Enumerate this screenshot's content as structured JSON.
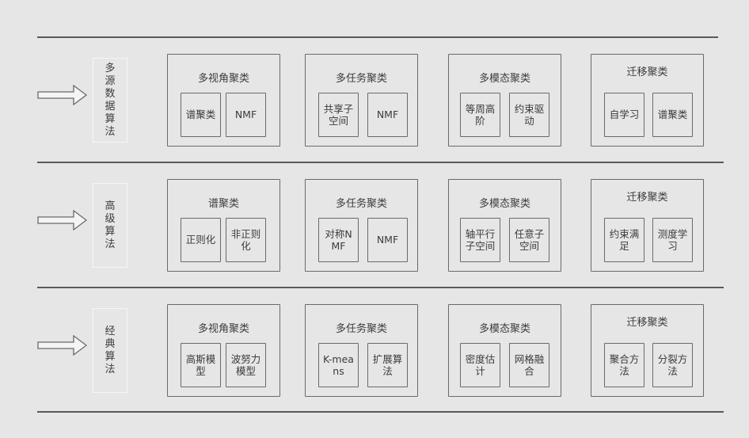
{
  "rows": [
    {
      "label": "多源数据算法",
      "groups": [
        {
          "title": "多视角聚类",
          "items": [
            "谱聚类",
            "NMF"
          ]
        },
        {
          "title": "多任务聚类",
          "items": [
            "共享子空间",
            "NMF"
          ]
        },
        {
          "title": "多模态聚类",
          "items": [
            "等周高阶",
            "约束驱动"
          ]
        },
        {
          "title": "迁移聚类",
          "items": [
            "自学习",
            "谱聚类"
          ]
        }
      ]
    },
    {
      "label": "高级算法",
      "groups": [
        {
          "title": "谱聚类",
          "items": [
            "正则化",
            "非正则化"
          ]
        },
        {
          "title": "多任务聚类",
          "items": [
            "对称NMF",
            "NMF"
          ]
        },
        {
          "title": "多模态聚类",
          "items": [
            "轴平行子空间",
            "任意子空间"
          ]
        },
        {
          "title": "迁移聚类",
          "items": [
            "约束满足",
            "测度学习"
          ]
        }
      ]
    },
    {
      "label": "经典算法",
      "groups": [
        {
          "title": "多视角聚类",
          "items": [
            "高斯模型",
            "波努力模型"
          ]
        },
        {
          "title": "多任务聚类",
          "items": [
            "K-means",
            "扩展算法"
          ]
        },
        {
          "title": "多模态聚类",
          "items": [
            "密度估计",
            "网格融合"
          ]
        },
        {
          "title": "迁移聚类",
          "items": [
            "聚合方法",
            "分裂方法"
          ]
        }
      ]
    }
  ]
}
